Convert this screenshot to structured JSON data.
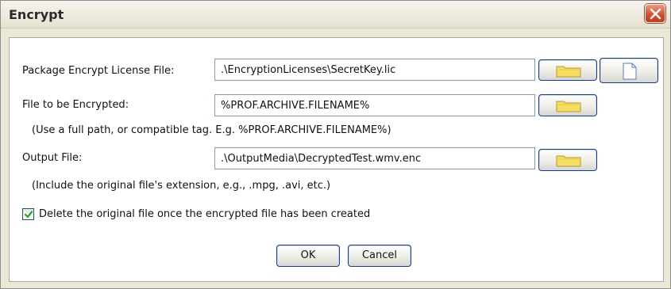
{
  "window": {
    "title": "Encrypt"
  },
  "fields": {
    "license_label": "Package Encrypt License File:",
    "license_value": ".\\EncryptionLicenses\\SecretKey.lic",
    "input_label": "File to be Encrypted:",
    "input_value": "%PROF.ARCHIVE.FILENAME%",
    "input_hint": "(Use a full path, or compatible tag. E.g. %PROF.ARCHIVE.FILENAME%)",
    "output_label": "Output File:",
    "output_value": ".\\OutputMedia\\DecryptedTest.wmv.enc",
    "output_hint": "(Include the original file's extension, e.g., .mpg, .avi, etc.)"
  },
  "options": {
    "delete_original_label": "Delete the original file once the encrypted file has been created",
    "delete_original_checked": true
  },
  "buttons": {
    "ok_label": "OK",
    "cancel_label": "Cancel"
  },
  "icons": {
    "browse": "folder-icon",
    "new_file": "document-icon",
    "close": "close-icon",
    "check": "checkmark-icon"
  },
  "colors": {
    "close_button": "#d44a2a",
    "folder": "#f5de62",
    "checkmark": "#21a121",
    "button_border": "#1c3a8a"
  }
}
